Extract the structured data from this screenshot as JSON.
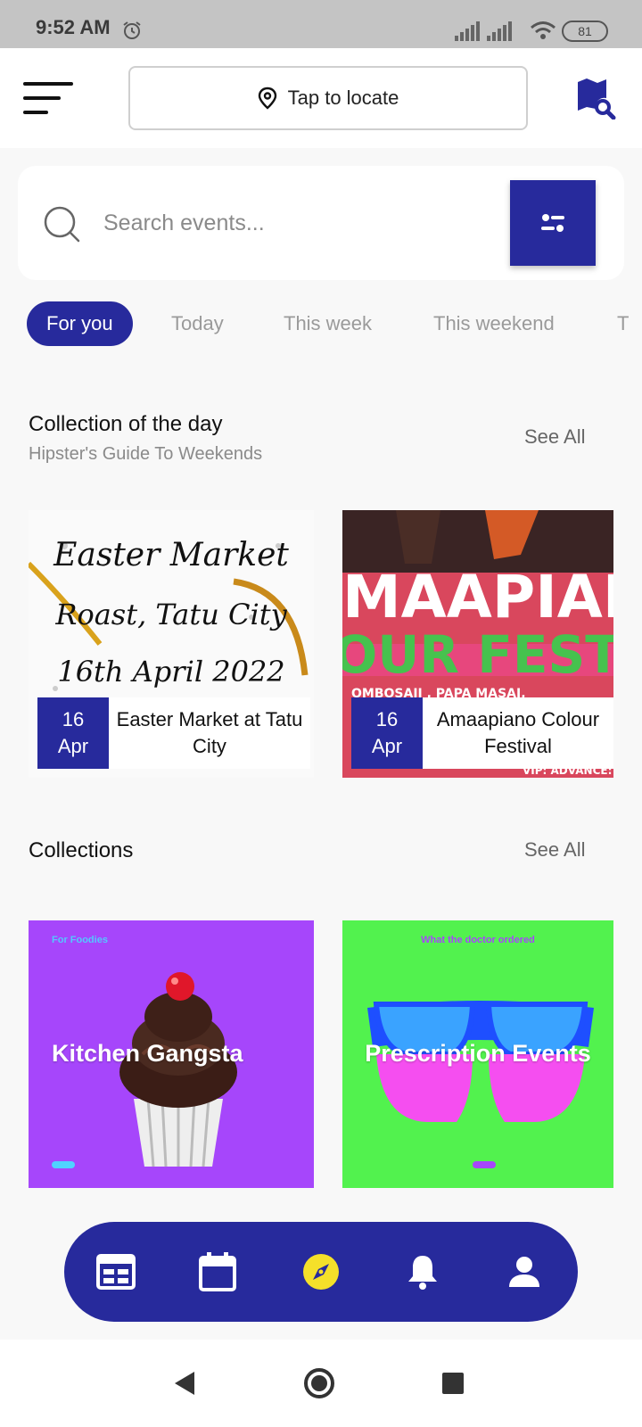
{
  "status_bar": {
    "time": "9:52 AM",
    "battery": "81"
  },
  "header": {
    "locate_label": "Tap to locate"
  },
  "search": {
    "placeholder": "Search events..."
  },
  "tabs": [
    {
      "label": "For you",
      "active": true
    },
    {
      "label": "Today",
      "active": false
    },
    {
      "label": "This week",
      "active": false
    },
    {
      "label": "This weekend",
      "active": false
    },
    {
      "label": "T",
      "active": false
    }
  ],
  "collection_of_day": {
    "title": "Collection of the day",
    "subtitle": "Hipster's Guide To Weekends",
    "see_all": "See All",
    "events": [
      {
        "day": "16",
        "month": "Apr",
        "name": "Easter Market at Tatu City",
        "poster_lines": [
          "Easter Market",
          "Roast, Tatu City",
          "16th April 2022"
        ]
      },
      {
        "day": "16",
        "month": "Apr",
        "name": "Amaapiano Colour Festival",
        "poster_lines": [
          "MAAPIAN",
          "OUR FEST",
          "OMBOSAJI , PAPA MASAI, ",
          "VIP: ADVANCE:"
        ]
      }
    ]
  },
  "collections": {
    "title": "Collections",
    "see_all": "See All",
    "items": [
      {
        "tag": "For Foodies",
        "title": "Kitchen Gangsta",
        "bg": "#a646fb",
        "dot": "#4fd3ff"
      },
      {
        "tag": "What the doctor ordered",
        "title": "Prescription Events",
        "bg": "#52f24e",
        "dot": "#a646fb"
      }
    ]
  },
  "bottom_nav": {
    "items": [
      "news-icon",
      "calendar-icon",
      "compass-icon",
      "bell-icon",
      "person-icon"
    ],
    "active_color": "#f5e02a"
  },
  "colors": {
    "primary": "#272a9c",
    "background": "#f8f8f8"
  }
}
